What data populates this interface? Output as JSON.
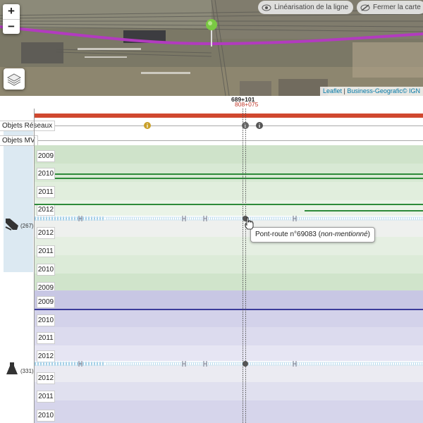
{
  "map": {
    "zoom_in": "+",
    "zoom_out": "−",
    "btn_linearisation": "Linéarisation de la ligne",
    "btn_close": "Fermer la carte",
    "attribution": {
      "leaflet": "Leaflet",
      "sep": " | ",
      "provider": "Business-Geografic",
      "copy": "© IGN"
    },
    "route_color": "#b23bbf",
    "marker_color": "#7ac943"
  },
  "timeline": {
    "km_primary": "689+101",
    "km_secondary": "808+075",
    "categories": [
      {
        "label": "Objets Réseaux"
      },
      {
        "label": "Objets MV"
      }
    ],
    "groups": [
      {
        "count": "(267)",
        "icon": "track-machine-icon",
        "color": "#d9e9d4",
        "years_top": [
          "2009",
          "2010",
          "2011",
          "2012"
        ],
        "years_bottom": [
          "2012",
          "2011",
          "2010",
          "2009"
        ]
      },
      {
        "count": "(331)",
        "icon": "flask-icon",
        "color": "#d5d3ea",
        "years_top": [
          "2009",
          "2010",
          "2011",
          "2012"
        ],
        "years_bottom": [
          "2012",
          "2011",
          "2010"
        ]
      }
    ],
    "tooltip": {
      "text": "Pont-route n°69083 (",
      "emph": "non-mentionné",
      "end": ")"
    },
    "colors": {
      "red_bar": "#d0482f",
      "green_line": "#2e8b3a",
      "blue_line": "#3b3b9a",
      "track": "#9ecde6"
    }
  }
}
